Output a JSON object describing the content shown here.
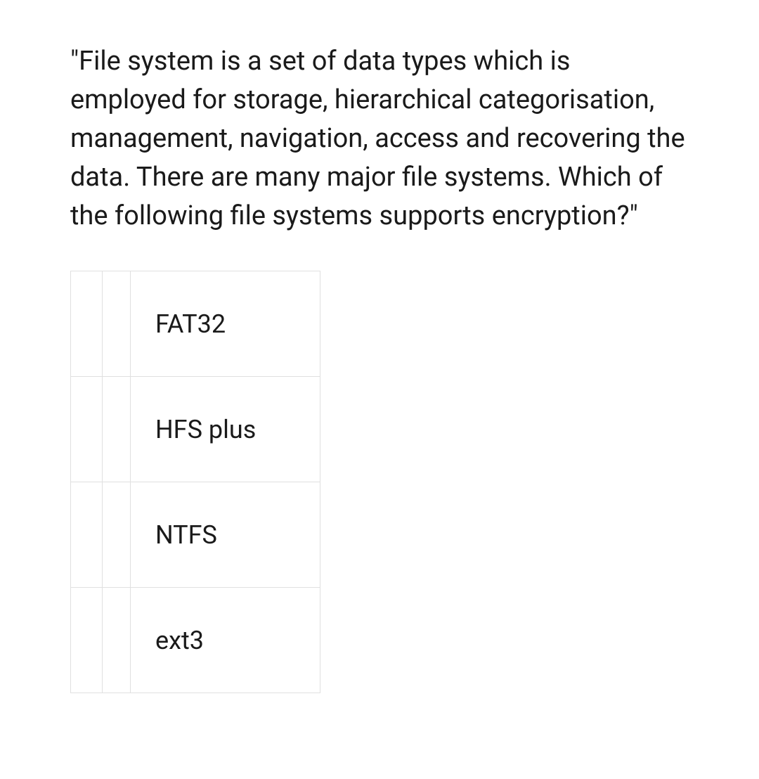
{
  "question": {
    "text": "\"File system is a set of data types which is employed for storage, hierarchical categorisation, management, navigation, access and recovering the data. There are many major file systems. Which of the following file systems supports encryption?\""
  },
  "options": [
    {
      "label": "FAT32"
    },
    {
      "label": "HFS plus"
    },
    {
      "label": "NTFS"
    },
    {
      "label": "ext3"
    }
  ]
}
